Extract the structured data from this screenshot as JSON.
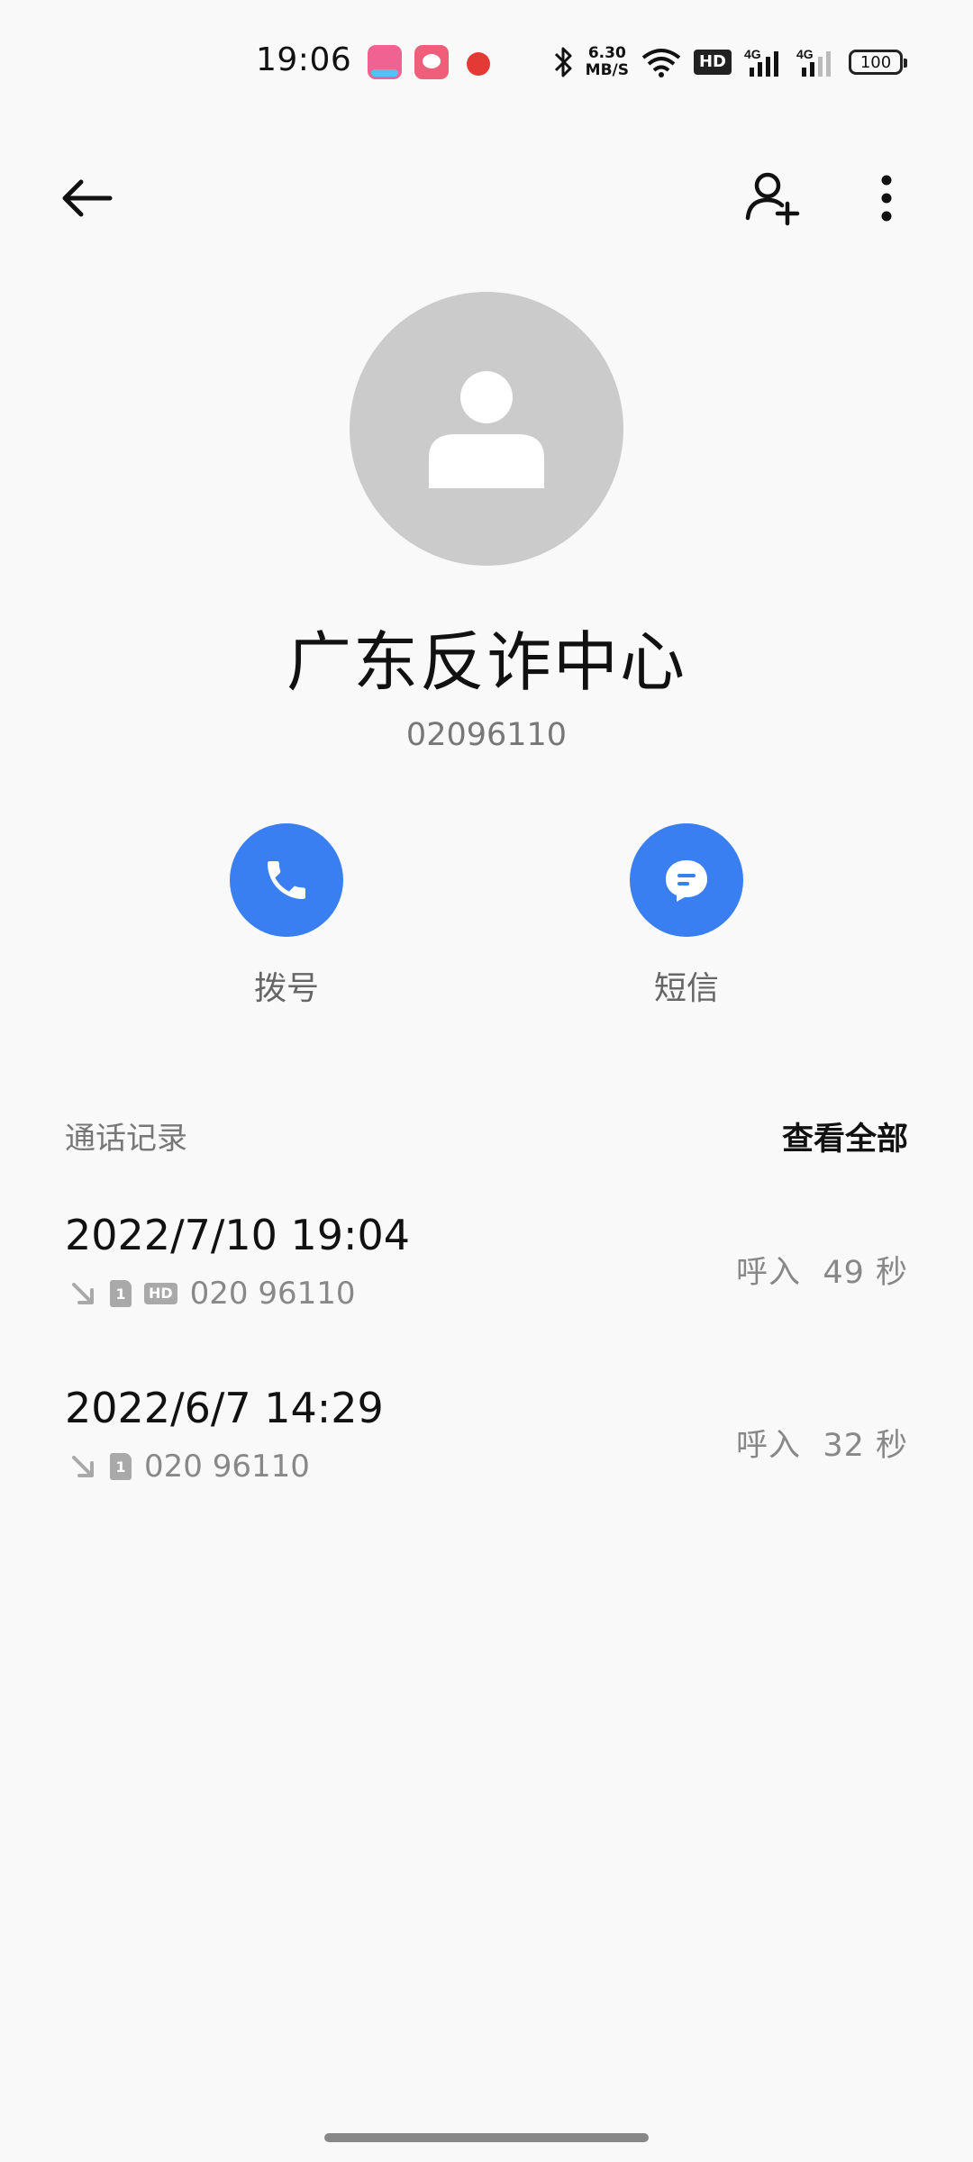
{
  "status_bar": {
    "time": "19:06",
    "net_speed_value": "6.30",
    "net_speed_unit": "MB/S",
    "volte": "HD",
    "signal1": "4G",
    "signal2": "4G",
    "battery": "100"
  },
  "contact": {
    "name": "广东反诈中心",
    "number": "02096110"
  },
  "actions": {
    "call_label": "拨号",
    "sms_label": "短信"
  },
  "history": {
    "title": "通话记录",
    "view_all": "查看全部",
    "records": [
      {
        "datetime": "2022/7/10 19:04",
        "sim": "1",
        "hd": "HD",
        "number": "020 96110",
        "type": "呼入",
        "duration": "49 秒"
      },
      {
        "datetime": "2022/6/7 14:29",
        "sim": "1",
        "number": "020 96110",
        "type": "呼入",
        "duration": "32 秒"
      }
    ]
  },
  "colors": {
    "accent": "#3a7ff2",
    "avatar_bg": "#cbcbcb",
    "background": "#f9f9f9"
  },
  "icons": {
    "back": "arrow-left-icon",
    "add_contact": "person-add-icon",
    "more": "more-vertical-icon",
    "call": "phone-icon",
    "sms": "message-icon",
    "incoming": "incoming-call-icon"
  }
}
